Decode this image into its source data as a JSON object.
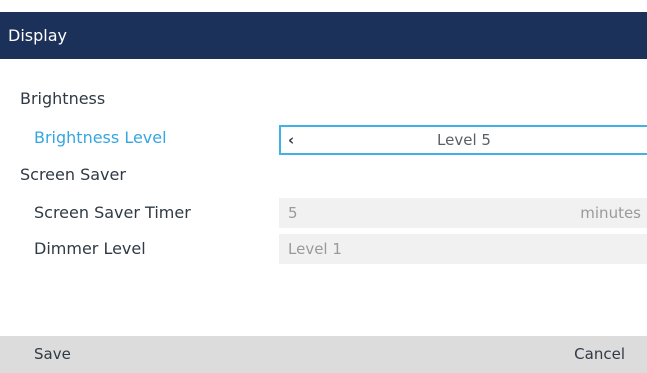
{
  "title_bar": {
    "title": "Display"
  },
  "sections": {
    "brightness": {
      "heading": "Brightness",
      "level_label": "Brightness Level",
      "level_value": "Level 5"
    },
    "screen_saver": {
      "heading": "Screen Saver",
      "timer_label": "Screen Saver Timer",
      "timer_value": "5",
      "timer_unit": "minutes",
      "dimmer_label": "Dimmer Level",
      "dimmer_value": "Level 1"
    }
  },
  "softkeys": {
    "save_label": "Save",
    "cancel_label": "Cancel"
  },
  "icons": {
    "left_arrow": "chevron-left-icon"
  },
  "colors": {
    "title_bar_bg": "#1c3159",
    "accent": "#35a6e0",
    "focus_border": "#41b1e6",
    "softkey_bar_bg": "#dcdcdc"
  }
}
